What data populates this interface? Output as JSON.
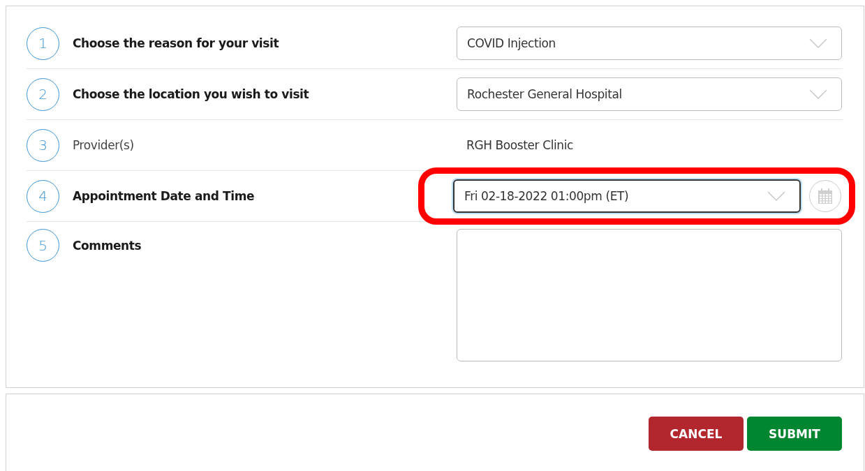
{
  "steps": [
    {
      "number": "1",
      "label": "Choose the reason for your visit",
      "kind": "select",
      "value": "COVID Injection"
    },
    {
      "number": "2",
      "label": "Choose the location you wish to visit",
      "kind": "select",
      "value": "Rochester General Hospital"
    },
    {
      "number": "3",
      "label": "Provider(s)",
      "kind": "text",
      "value": "RGH Booster Clinic"
    },
    {
      "number": "4",
      "label": "Appointment Date and Time",
      "kind": "datetime",
      "value": "Fri 02-18-2022 01:00pm (ET)",
      "highlighted": true
    },
    {
      "number": "5",
      "label": "Comments",
      "kind": "textarea"
    }
  ],
  "buttons": [
    {
      "label": "CANCEL",
      "kind": "cancel"
    },
    {
      "label": "SUBMIT",
      "kind": "submit"
    }
  ]
}
